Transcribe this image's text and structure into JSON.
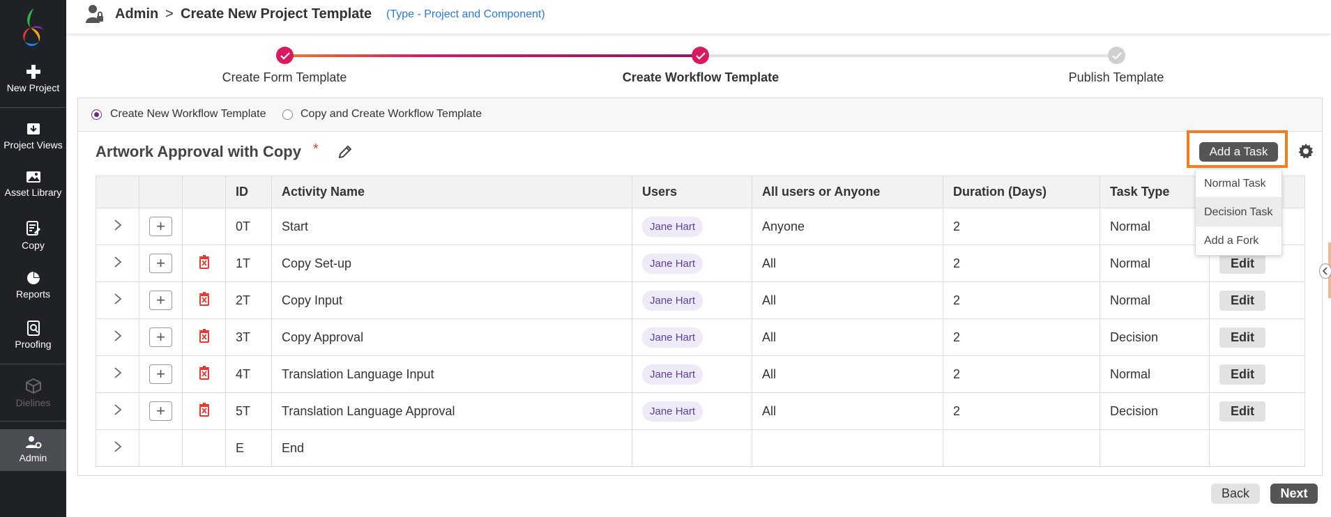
{
  "sidebar": {
    "items": [
      {
        "label": "New Project",
        "icon": "plus-icon"
      },
      {
        "label": "Project Views",
        "icon": "inbox-download-icon"
      },
      {
        "label": "Asset Library",
        "icon": "image-icon"
      },
      {
        "label": "Copy",
        "icon": "document-edit-icon"
      },
      {
        "label": "Reports",
        "icon": "pie-chart-icon"
      },
      {
        "label": "Proofing",
        "icon": "document-search-icon"
      },
      {
        "label": "Dielines",
        "icon": "box-icon",
        "disabled": true
      },
      {
        "label": "Admin",
        "icon": "user-gear-icon",
        "active": true
      }
    ]
  },
  "header": {
    "section": "Admin",
    "separator": ">",
    "page_title": "Create New Project Template",
    "subtitle": "(Type - Project and Component)"
  },
  "stepper": {
    "steps": [
      {
        "label": "Create Form Template",
        "state": "complete"
      },
      {
        "label": "Create Workflow Template",
        "state": "complete",
        "current": true
      },
      {
        "label": "Publish Template",
        "state": "pending"
      }
    ]
  },
  "workflow_options": {
    "option_new": "Create New Workflow Template",
    "option_copy": "Copy and Create Workflow Template",
    "selected": "option_new"
  },
  "workflow": {
    "title": "Artwork Approval with Copy",
    "required_mark": "*",
    "add_task_label": "Add a Task"
  },
  "table": {
    "columns": [
      "ID",
      "Activity Name",
      "Users",
      "All users or Anyone",
      "Duration (Days)",
      "Task Type"
    ],
    "edit_label": "Edit",
    "rows": [
      {
        "id": "0T",
        "name": "Start",
        "user": "Jane Hart",
        "scope": "Anyone",
        "duration": "2",
        "type": "Normal"
      },
      {
        "id": "1T",
        "name": "Copy Set-up",
        "user": "Jane Hart",
        "scope": "All",
        "duration": "2",
        "type": "Normal"
      },
      {
        "id": "2T",
        "name": "Copy Input",
        "user": "Jane Hart",
        "scope": "All",
        "duration": "2",
        "type": "Normal"
      },
      {
        "id": "3T",
        "name": "Copy Approval",
        "user": "Jane Hart",
        "scope": "All",
        "duration": "2",
        "type": "Decision"
      },
      {
        "id": "4T",
        "name": "Translation Language Input",
        "user": "Jane Hart",
        "scope": "All",
        "duration": "2",
        "type": "Normal"
      },
      {
        "id": "5T",
        "name": "Translation Language Approval",
        "user": "Jane Hart",
        "scope": "All",
        "duration": "2",
        "type": "Decision"
      },
      {
        "id": "E",
        "name": "End",
        "user": "",
        "scope": "",
        "duration": "",
        "type": ""
      }
    ]
  },
  "add_task_menu": {
    "items": [
      "Normal Task",
      "Decision Task",
      "Add a Fork"
    ],
    "hovered": "Decision Task"
  },
  "footer": {
    "back_label": "Back",
    "next_label": "Next"
  },
  "colors": {
    "sidebar_bg": "#1e2125",
    "accent_purple": "#6b2a8a",
    "step_red": "#d81b60",
    "highlight_orange": "#f57c1f",
    "link_blue": "#2a7bd6",
    "delete_red": "#e53935"
  }
}
